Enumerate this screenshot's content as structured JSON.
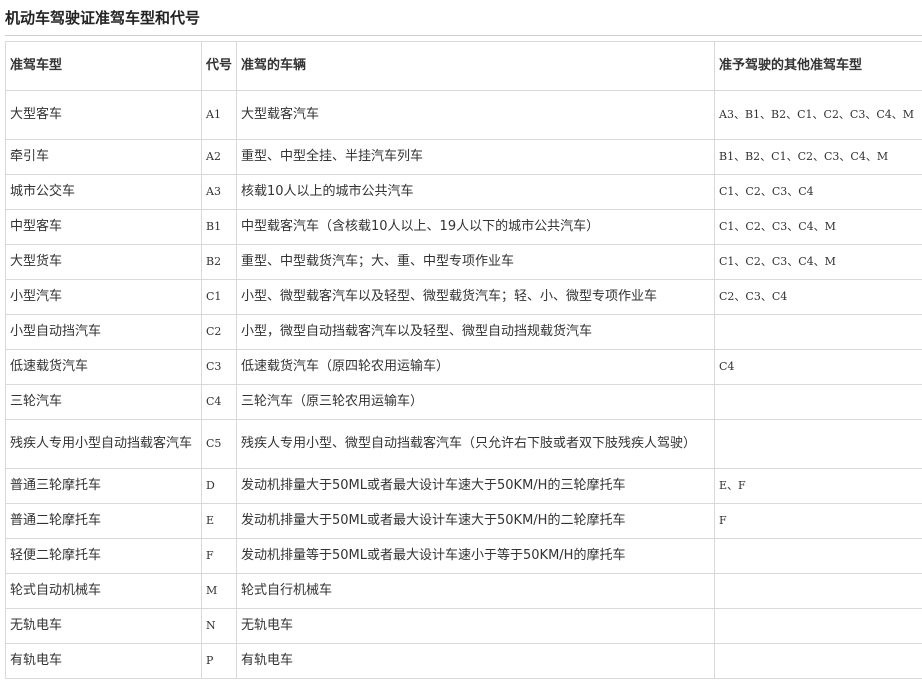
{
  "title": "机动车驾驶证准驾车型和代号",
  "headers": {
    "vehicle_type": "准驾车型",
    "code": "代号",
    "vehicles": "准驾的车辆",
    "other_types": "准予驾驶的其他准驾车型"
  },
  "rows": [
    {
      "type": "大型客车",
      "code": "A1",
      "vehicles": "大型载客汽车",
      "others": "A3、B1、B2、C1、C2、C3、C4、M"
    },
    {
      "type": "牵引车",
      "code": "A2",
      "vehicles": "重型、中型全挂、半挂汽车列车",
      "others": "B1、B2、C1、C2、C3、C4、M"
    },
    {
      "type": "城市公交车",
      "code": "A3",
      "vehicles": "核载10人以上的城市公共汽车",
      "others": "C1、C2、C3、C4"
    },
    {
      "type": "中型客车",
      "code": "B1",
      "vehicles": "中型载客汽车（含核载10人以上、19人以下的城市公共汽车）",
      "others": "C1、C2、C3、C4、M"
    },
    {
      "type": "大型货车",
      "code": "B2",
      "vehicles": "重型、中型载货汽车；大、重、中型专项作业车",
      "others": "C1、C2、C3、C4、M"
    },
    {
      "type": "小型汽车",
      "code": "C1",
      "vehicles": "小型、微型载客汽车以及轻型、微型载货汽车；轻、小、微型专项作业车",
      "others": "C2、C3、C4"
    },
    {
      "type": "小型自动挡汽车",
      "code": "C2",
      "vehicles": "小型，微型自动挡载客汽车以及轻型、微型自动挡规载货汽车",
      "others": ""
    },
    {
      "type": "低速载货汽车",
      "code": "C3",
      "vehicles": "低速载货汽车（原四轮农用运输车）",
      "others": "C4"
    },
    {
      "type": "三轮汽车",
      "code": "C4",
      "vehicles": "三轮汽车（原三轮农用运输车）",
      "others": ""
    },
    {
      "type": "残疾人专用小型自动挡载客汽车",
      "code": "C5",
      "vehicles": "残疾人专用小型、微型自动挡载客汽车（只允许右下肢或者双下肢残疾人驾驶）",
      "others": ""
    },
    {
      "type": "普通三轮摩托车",
      "code": "D",
      "vehicles": "发动机排量大于50ML或者最大设计车速大于50KM/H的三轮摩托车",
      "others": "E、F"
    },
    {
      "type": "普通二轮摩托车",
      "code": "E",
      "vehicles": "发动机排量大于50ML或者最大设计车速大于50KM/H的二轮摩托车",
      "others": "F"
    },
    {
      "type": "轻便二轮摩托车",
      "code": "F",
      "vehicles": "发动机排量等于50ML或者最大设计车速小于等于50KM/H的摩托车",
      "others": ""
    },
    {
      "type": "轮式自动机械车",
      "code": "M",
      "vehicles": "轮式自行机械车",
      "others": ""
    },
    {
      "type": "无轨电车",
      "code": "N",
      "vehicles": "无轨电车",
      "others": ""
    },
    {
      "type": "有轨电车",
      "code": "P",
      "vehicles": "有轨电车",
      "others": ""
    }
  ]
}
